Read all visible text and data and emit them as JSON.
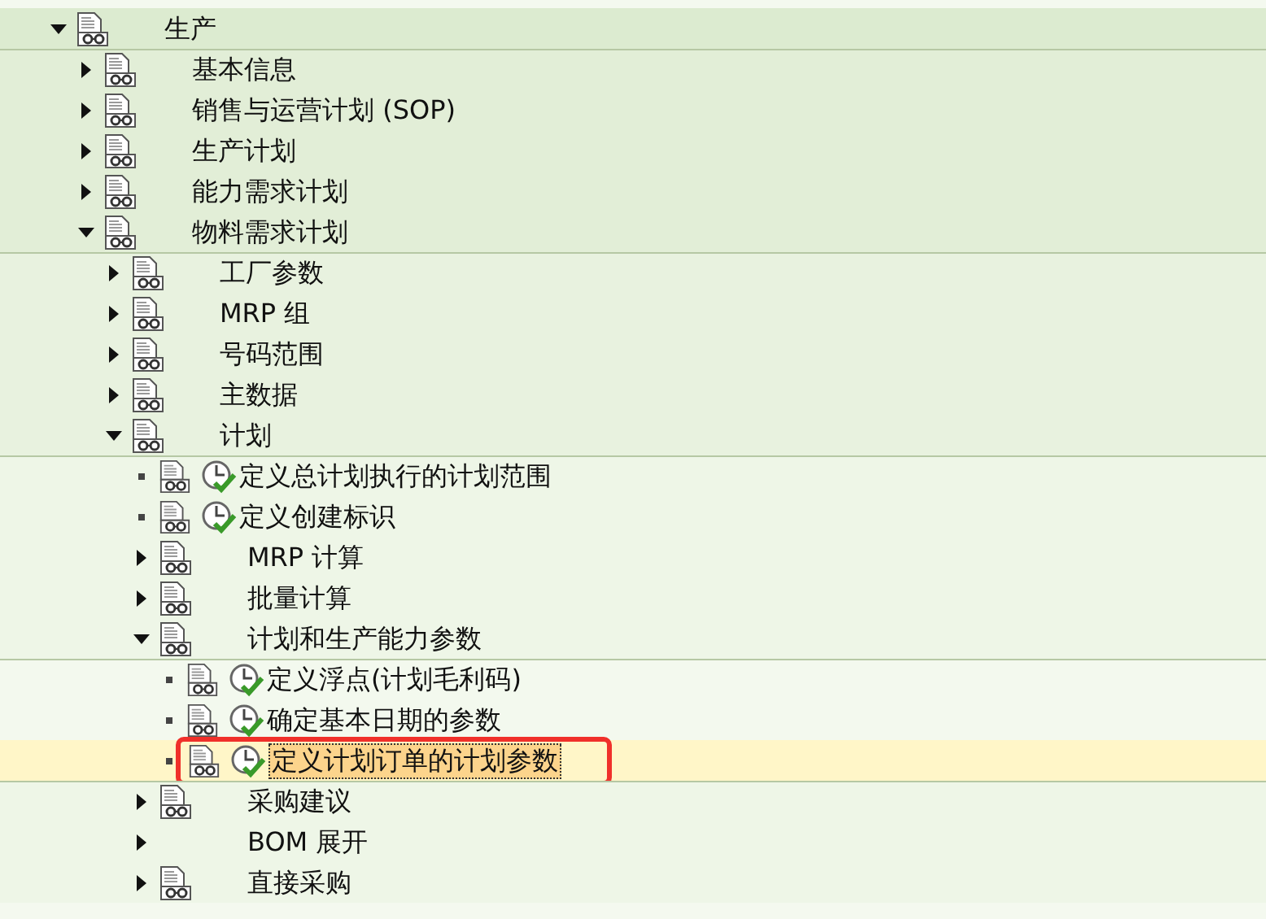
{
  "tree": [
    {
      "label": "生产",
      "kind": "folder",
      "expanded": true,
      "selected": false,
      "children": [
        {
          "label": "基本信息",
          "kind": "folder",
          "expanded": false,
          "selected": false
        },
        {
          "label": "销售与运营计划 (SOP)",
          "kind": "folder",
          "expanded": false,
          "selected": false
        },
        {
          "label": "生产计划",
          "kind": "folder",
          "expanded": false,
          "selected": false
        },
        {
          "label": "能力需求计划",
          "kind": "folder",
          "expanded": false,
          "selected": false
        },
        {
          "label": "物料需求计划",
          "kind": "folder",
          "expanded": true,
          "selected": false,
          "children": [
            {
              "label": "工厂参数",
              "kind": "folder",
              "expanded": false,
              "selected": false
            },
            {
              "label": "MRP 组",
              "kind": "folder",
              "expanded": false,
              "selected": false
            },
            {
              "label": "号码范围",
              "kind": "folder",
              "expanded": false,
              "selected": false
            },
            {
              "label": "主数据",
              "kind": "folder",
              "expanded": false,
              "selected": false
            },
            {
              "label": "计划",
              "kind": "folder",
              "expanded": true,
              "selected": false,
              "children": [
                {
                  "label": "定义总计划执行的计划范围",
                  "kind": "activity",
                  "selected": false
                },
                {
                  "label": "定义创建标识",
                  "kind": "activity",
                  "selected": false
                },
                {
                  "label": "MRP 计算",
                  "kind": "folder",
                  "expanded": false,
                  "selected": false
                },
                {
                  "label": "批量计算",
                  "kind": "folder",
                  "expanded": false,
                  "selected": false
                },
                {
                  "label": "计划和生产能力参数",
                  "kind": "folder",
                  "expanded": true,
                  "selected": false,
                  "children": [
                    {
                      "label": "定义浮点(计划毛利码)",
                      "kind": "activity",
                      "selected": false
                    },
                    {
                      "label": "确定基本日期的参数",
                      "kind": "activity",
                      "selected": false
                    },
                    {
                      "label": "定义计划订单的计划参数",
                      "kind": "activity",
                      "selected": true
                    }
                  ]
                },
                {
                  "label": "采购建议",
                  "kind": "folder",
                  "expanded": false,
                  "selected": false
                },
                {
                  "label": "BOM 展开",
                  "kind": "plain",
                  "expanded": false,
                  "selected": false
                },
                {
                  "label": "直接采购",
                  "kind": "folder",
                  "expanded": false,
                  "selected": false
                }
              ]
            }
          ]
        }
      ]
    }
  ]
}
